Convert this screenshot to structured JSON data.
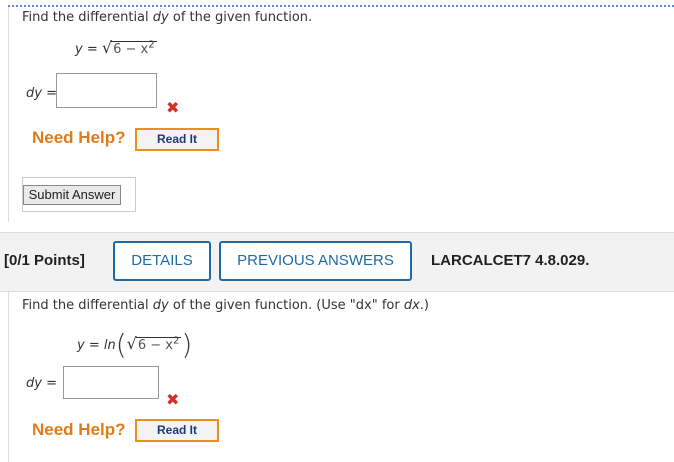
{
  "question1": {
    "prompt_pre": "Find the differential ",
    "prompt_var": "dy",
    "prompt_post": " of the given function.",
    "eq_lhs": "y = ",
    "radicand": "6 − x",
    "exponent": "2",
    "answer_label": "dy",
    "answer_eq": " =",
    "answer_value": "",
    "status_icon": "incorrect-x",
    "need_help": "Need Help?",
    "read_it": "Read It",
    "submit": "Submit Answer"
  },
  "header": {
    "points": "[0/1 Points]",
    "details": "DETAILS",
    "previous_answers": "PREVIOUS ANSWERS",
    "source": "LARCALCET7 4.8.029."
  },
  "question2": {
    "prompt_pre": "Find the differential ",
    "prompt_var": "dy",
    "prompt_mid": " of the given function. (Use \"dx\" for ",
    "prompt_var2": "dx",
    "prompt_end": ".)",
    "eq_lhs": "y = ln",
    "radicand": "6 − x",
    "exponent": "2",
    "answer_label": "dy",
    "answer_eq": " =",
    "answer_value": "",
    "status_icon": "incorrect-x",
    "need_help": "Need Help?",
    "read_it": "Read It"
  },
  "colors": {
    "accent_blue": "#1f6aa5",
    "help_orange": "#e07b1a",
    "error_red": "#d0312d"
  }
}
